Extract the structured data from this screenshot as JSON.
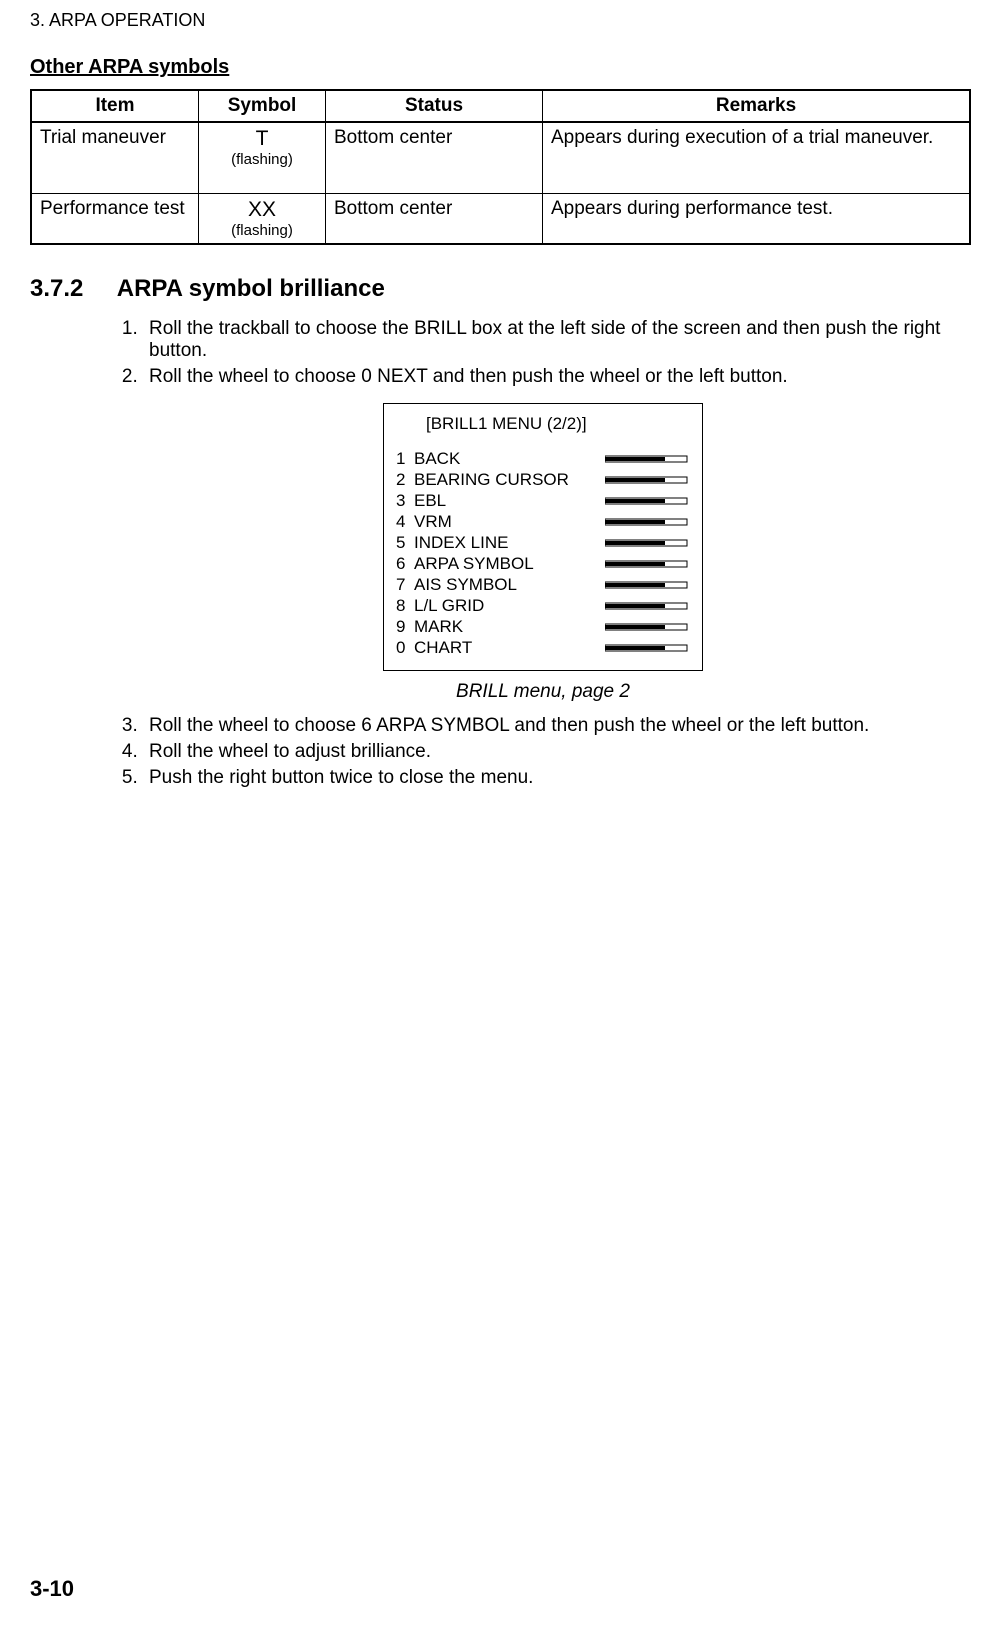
{
  "chapter": "3. ARPA OPERATION",
  "subsection_title": "Other ARPA symbols",
  "table": {
    "headers": {
      "item": "Item",
      "symbol": "Symbol",
      "status": "Status",
      "remarks": "Remarks"
    },
    "rows": [
      {
        "item": "Trial maneuver",
        "symbol_main": "T",
        "symbol_note": "(flashing)",
        "status": "Bottom center",
        "remarks": "Appears during execution of a trial maneuver."
      },
      {
        "item": "Performance test",
        "symbol_main": "XX",
        "symbol_note": "(flashing)",
        "status": "Bottom center",
        "remarks": "Appears during performance test."
      }
    ]
  },
  "section": {
    "number": "3.7.2",
    "title": "ARPA symbol brilliance",
    "steps_a": [
      "Roll the trackball to choose the BRILL box at the left side of the screen and then push the right button.",
      "Roll the wheel to choose 0 NEXT and then push the wheel or the left button."
    ],
    "steps_b": [
      "Roll the wheel to choose 6 ARPA SYMBOL and then push the wheel or the left button.",
      "Roll the wheel to adjust brilliance.",
      "Push the right button twice to close the menu."
    ]
  },
  "menu": {
    "title": "[BRILL1 MENU (2/2)]",
    "items": [
      {
        "num": "1",
        "label": "BACK"
      },
      {
        "num": "2",
        "label": "BEARING CURSOR"
      },
      {
        "num": "3",
        "label": "EBL"
      },
      {
        "num": "4",
        "label": "VRM"
      },
      {
        "num": "5",
        "label": "INDEX LINE"
      },
      {
        "num": "6",
        "label": "ARPA SYMBOL"
      },
      {
        "num": "7",
        "label": "AIS SYMBOL"
      },
      {
        "num": "8",
        "label": "L/L GRID"
      },
      {
        "num": "9",
        "label": "MARK"
      },
      {
        "num": "0",
        "label": "CHART"
      }
    ],
    "caption": "BRILL menu, page 2"
  },
  "page_number": "3-10"
}
